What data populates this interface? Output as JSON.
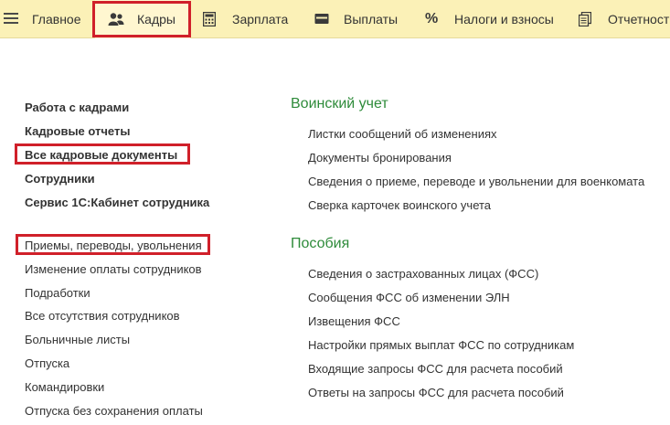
{
  "sections": {
    "home": "Главное",
    "hr": "Кадры",
    "salary": "Зарплата",
    "payments": "Выплаты",
    "taxes": "Налоги и взносы",
    "reports": "Отчетность"
  },
  "left_bold": [
    "Работа с кадрами",
    "Кадровые отчеты",
    "Все кадровые документы",
    "Сотрудники",
    "Сервис 1С:Кабинет сотрудника"
  ],
  "left_regular": [
    "Приемы, переводы, увольнения",
    "Изменение оплаты сотрудников",
    "Подработки",
    "Все отсутствия сотрудников",
    "Больничные листы",
    "Отпуска",
    "Командировки",
    "Отпуска без сохранения оплаты"
  ],
  "military": {
    "title": "Воинский учет",
    "items": [
      "Листки сообщений об изменениях",
      "Документы бронирования",
      "Сведения о приеме, переводе и увольнении для военкомата",
      "Сверка карточек воинского учета"
    ]
  },
  "benefits": {
    "title": "Пособия",
    "items": [
      "Сведения о застрахованных лицах (ФСС)",
      "Сообщения ФСС об изменении ЭЛН",
      "Извещения ФСС",
      "Настройки прямых выплат ФСС по сотрудникам",
      "Входящие запросы ФСС для расчета пособий",
      "Ответы на запросы ФСС для расчета пособий"
    ]
  },
  "colors": {
    "topbar": "#fbf1b7",
    "highlight": "#d0202a",
    "group_title": "#2e8b3a"
  }
}
